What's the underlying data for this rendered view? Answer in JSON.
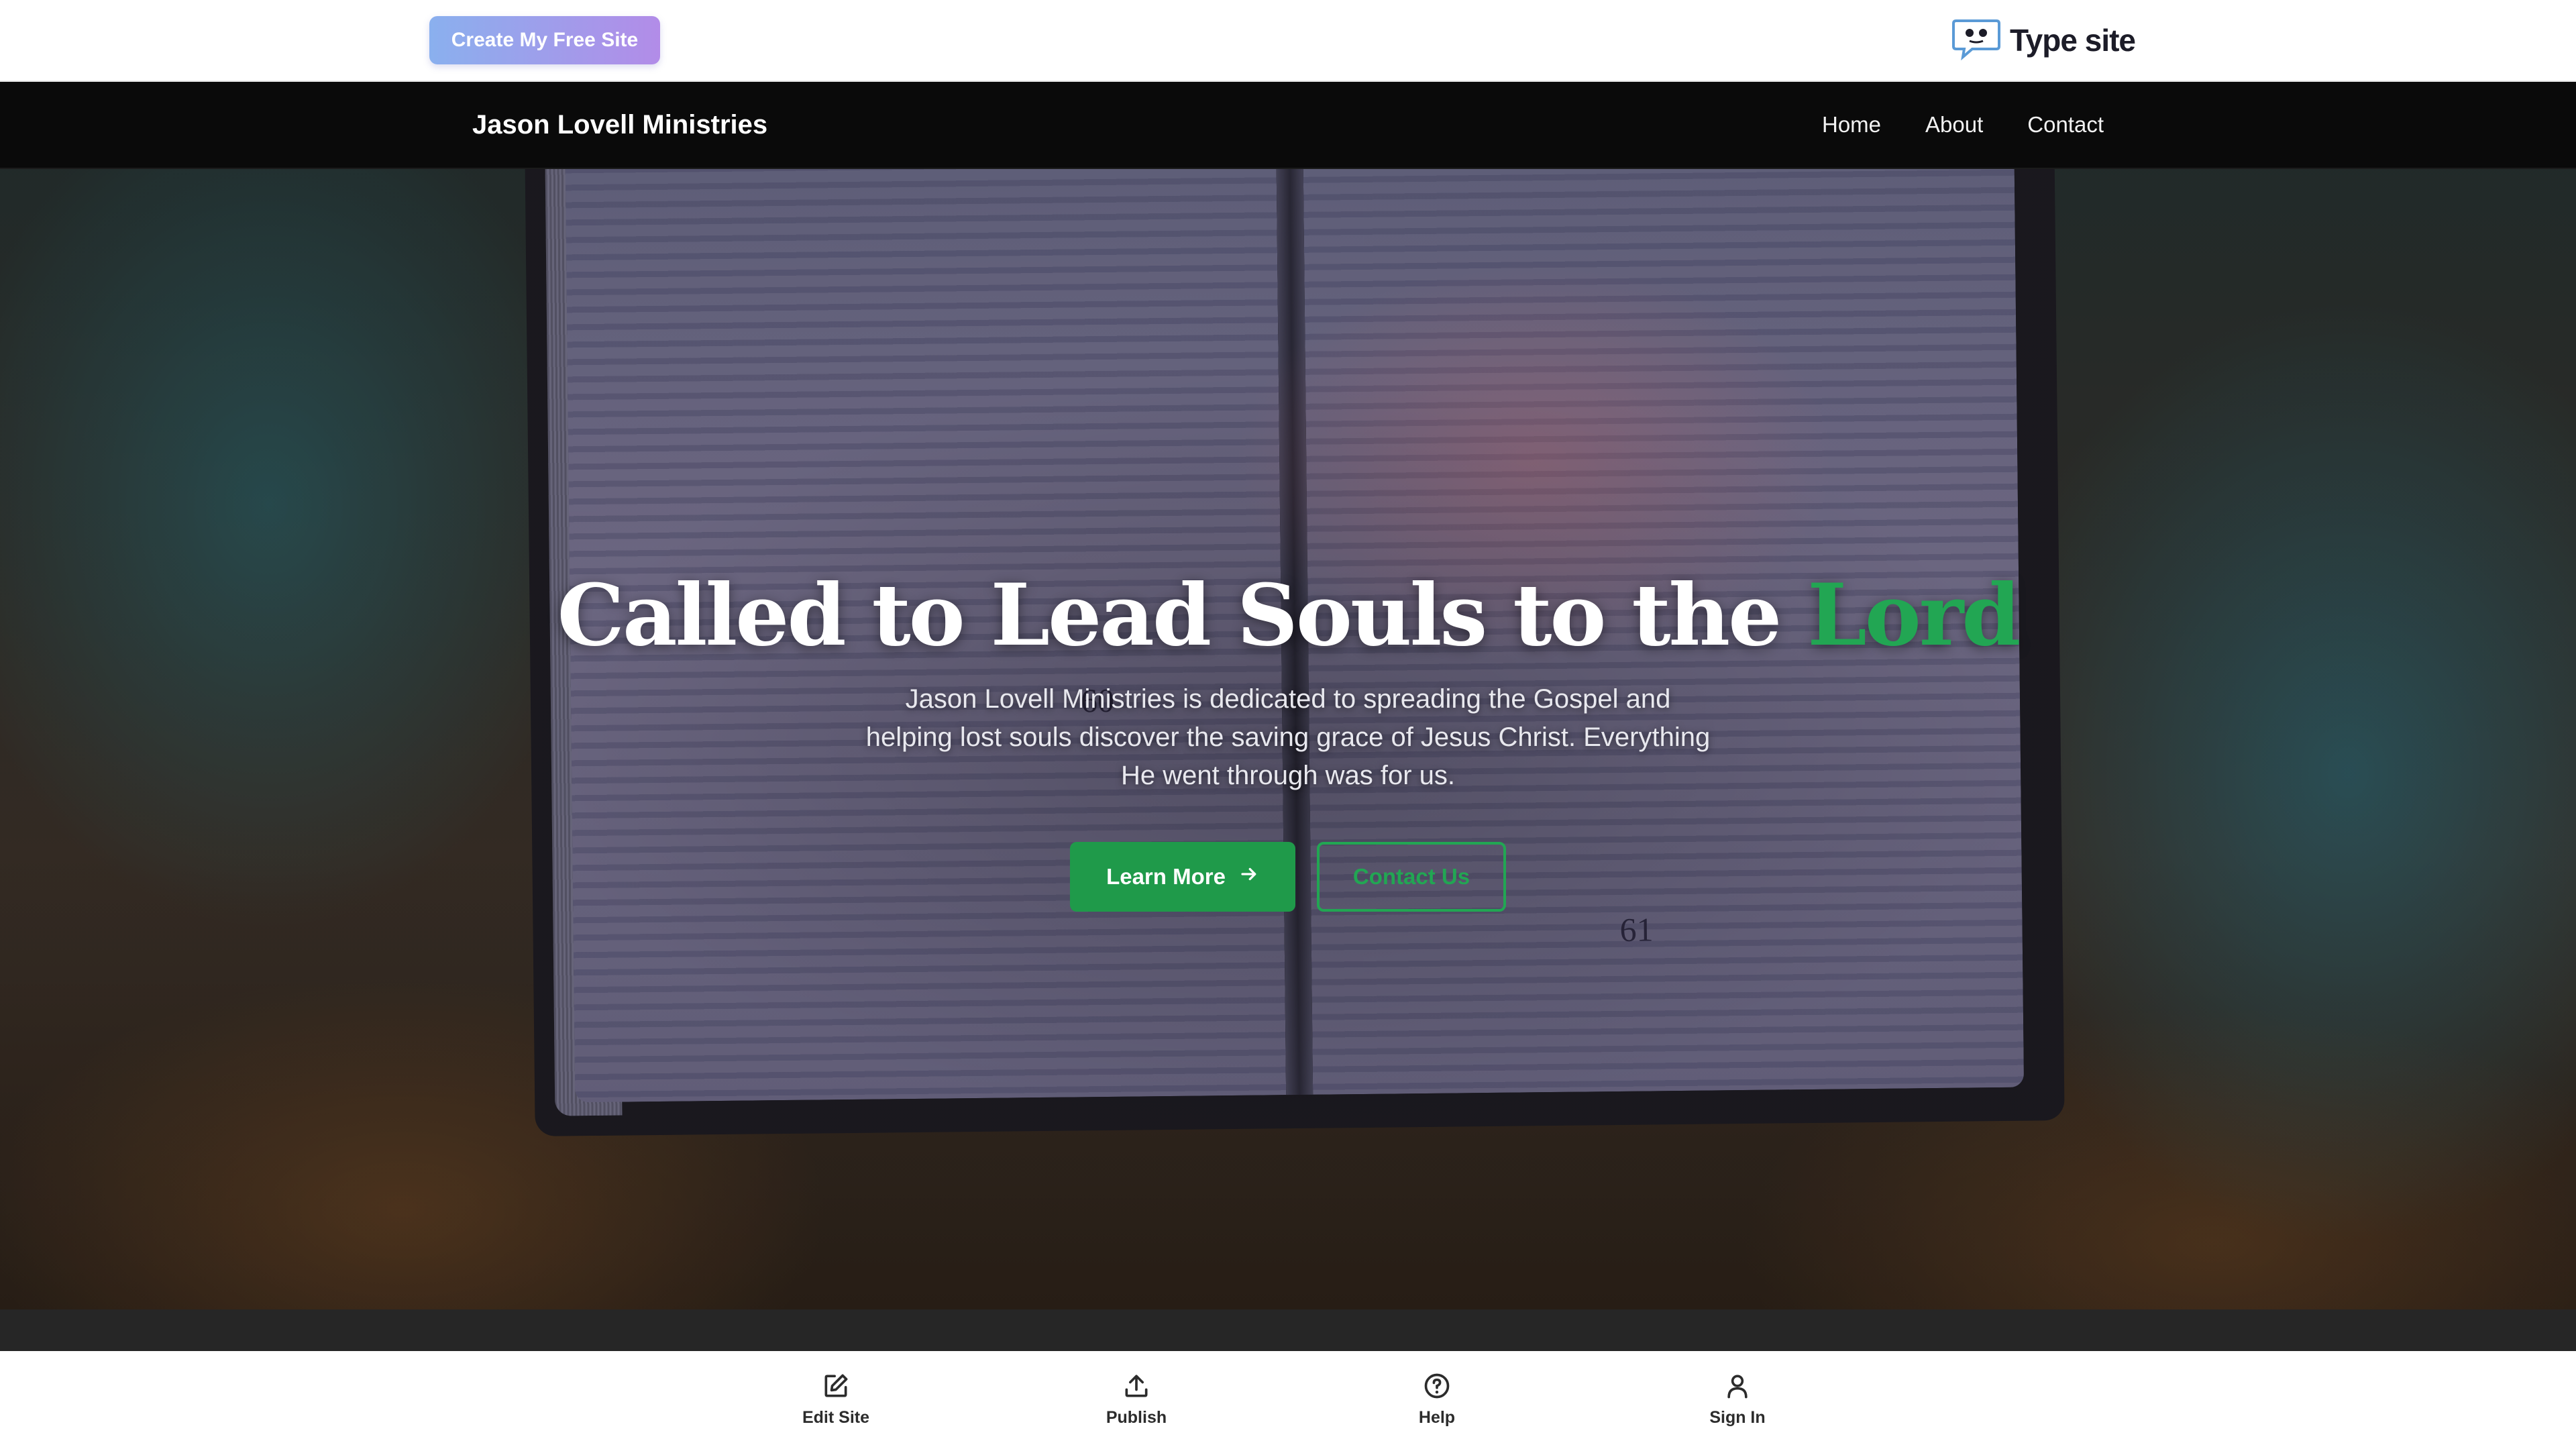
{
  "promo_bar": {
    "create_button_label": "Create My Free Site",
    "brand_icon": "speech-bubble-eyes-icon",
    "brand_name": "Type site"
  },
  "site_nav": {
    "title": "Jason Lovell Ministries",
    "links": [
      {
        "label": "Home"
      },
      {
        "label": "About"
      },
      {
        "label": "Contact"
      }
    ]
  },
  "hero": {
    "background": "open-bible-photo",
    "headline_main": "Called to Lead Souls to the",
    "headline_accent": "Lord",
    "subtitle": "Jason Lovell Ministries is dedicated to spreading the Gospel and helping lost souls discover the saving grace of Jesus Christ. Everything He went through was for us.",
    "primary_button": {
      "label": "Learn More",
      "icon": "arrow-right-icon"
    },
    "secondary_button": {
      "label": "Contact Us"
    },
    "colors": {
      "accent": "#22a653",
      "primary_button": "#1f9a4a"
    }
  },
  "toolbar": {
    "items": [
      {
        "label": "Edit Site",
        "icon": "edit-icon"
      },
      {
        "label": "Publish",
        "icon": "upload-icon"
      },
      {
        "label": "Help",
        "icon": "help-circle-icon"
      },
      {
        "label": "Sign In",
        "icon": "user-icon"
      }
    ]
  }
}
